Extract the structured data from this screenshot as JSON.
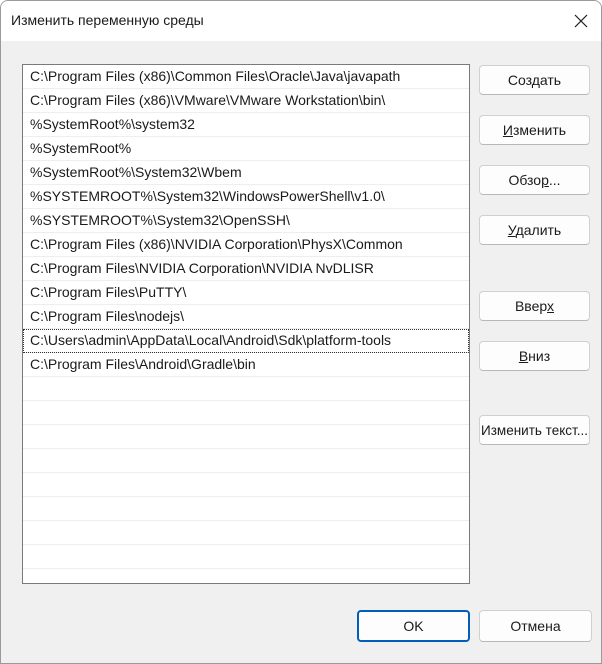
{
  "window": {
    "title": "Изменить переменную среды",
    "close_icon": "close-icon"
  },
  "paths": [
    "C:\\Program Files (x86)\\Common Files\\Oracle\\Java\\javapath",
    "C:\\Program Files (x86)\\VMware\\VMware Workstation\\bin\\",
    "%SystemRoot%\\system32",
    "%SystemRoot%",
    "%SystemRoot%\\System32\\Wbem",
    "%SYSTEMROOT%\\System32\\WindowsPowerShell\\v1.0\\",
    "%SYSTEMROOT%\\System32\\OpenSSH\\",
    "C:\\Program Files (x86)\\NVIDIA Corporation\\PhysX\\Common",
    "C:\\Program Files\\NVIDIA Corporation\\NVIDIA NvDLISR",
    "C:\\Program Files\\PuTTY\\",
    "C:\\Program Files\\nodejs\\",
    "C:\\Users\\admin\\AppData\\Local\\Android\\Sdk\\platform-tools",
    "C:\\Program Files\\Android\\Gradle\\bin"
  ],
  "buttons": {
    "new": "Создать",
    "edit_before": "",
    "edit_ul": "И",
    "edit_after": "зменить",
    "browse_before": "Обзо",
    "browse_ul": "р",
    "browse_after": "...",
    "delete_before": "",
    "delete_ul": "У",
    "delete_after": "далить",
    "up_before": "Ввер",
    "up_ul": "х",
    "up_after": "",
    "down_before": "",
    "down_ul": "В",
    "down_after": "низ",
    "edit_text": "Изменить текст...",
    "ok": "OK",
    "cancel": "Отмена"
  }
}
